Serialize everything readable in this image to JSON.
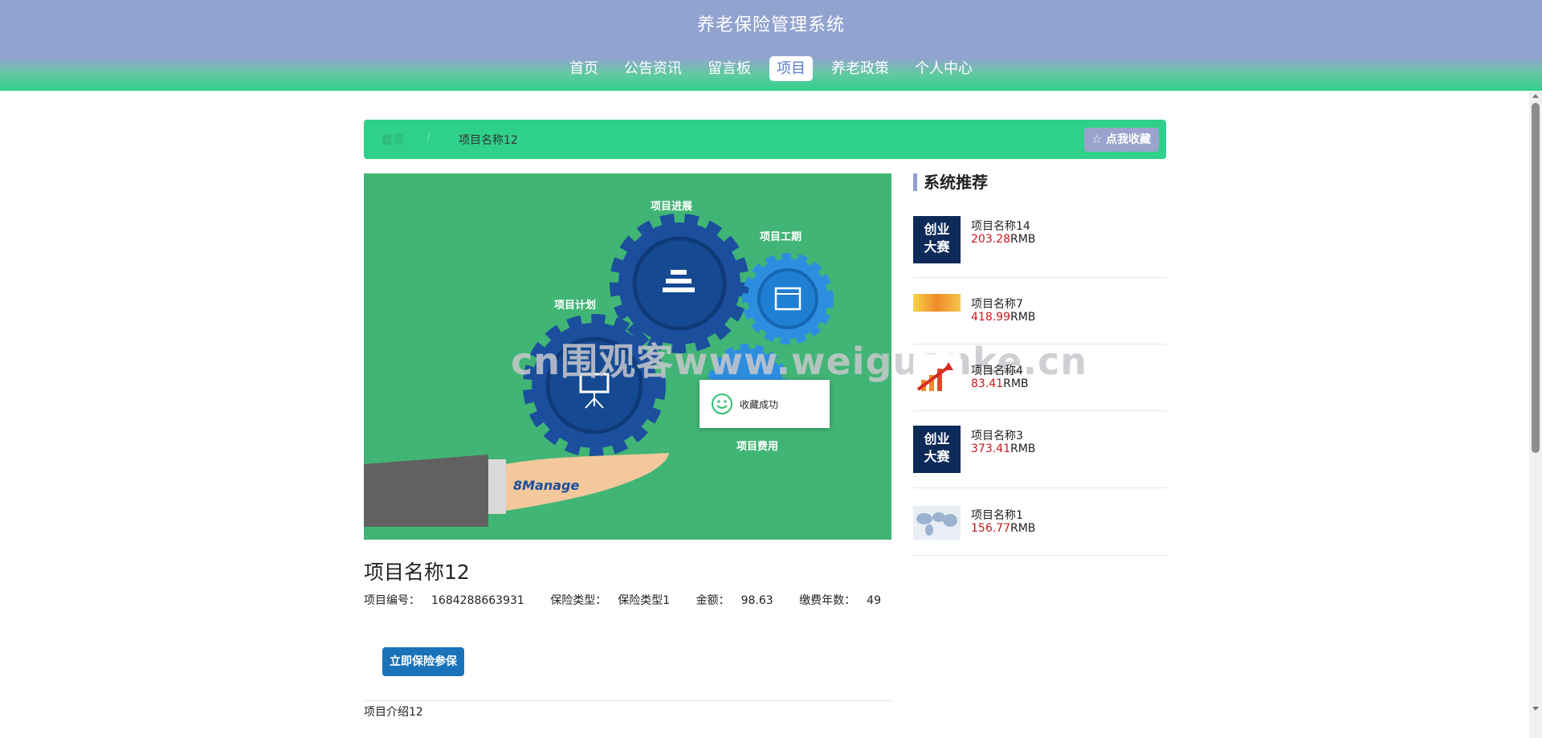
{
  "header": {
    "title": "养老保险管理系统",
    "nav": [
      "首页",
      "公告资讯",
      "留言板",
      "项目",
      "养老政策",
      "个人中心"
    ],
    "active_index": 3
  },
  "breadcrumb": {
    "home": "首页",
    "separator": "/",
    "current": "项目名称12",
    "favorite_label": "☆ 点我收藏"
  },
  "hero": {
    "labels": {
      "plan": "项目计划",
      "progress": "项目进展",
      "duration": "项目工期",
      "cost": "项目费用"
    },
    "brand": "8Manage"
  },
  "project": {
    "title": "项目名称12",
    "meta": [
      {
        "label": "项目编号：",
        "value": "1684288663931"
      },
      {
        "label": "保险类型：",
        "value": "保险类型1"
      },
      {
        "label": "金额：",
        "value": "98.63"
      },
      {
        "label": "缴费年数：",
        "value": "49"
      }
    ],
    "insure_label": "立即保险参保",
    "intro": "项目介绍12"
  },
  "sidebar": {
    "heading": "系统推荐",
    "currency": "RMB",
    "items": [
      {
        "name": "项目名称14",
        "price": "203.28",
        "thumb": "contest",
        "thumb_text": [
          "创业",
          "大赛"
        ]
      },
      {
        "name": "项目名称7",
        "price": "418.99",
        "thumb": "banner"
      },
      {
        "name": "项目名称4",
        "price": "83.41",
        "thumb": "growth"
      },
      {
        "name": "项目名称3",
        "price": "373.41",
        "thumb": "contest",
        "thumb_text": [
          "创业",
          "大赛"
        ]
      },
      {
        "name": "项目名称1",
        "price": "156.77",
        "thumb": "map"
      }
    ]
  },
  "watermark": "cn围观客www.weiguanke.cn",
  "toast": {
    "text": "收藏成功",
    "icon": "smile-icon"
  }
}
